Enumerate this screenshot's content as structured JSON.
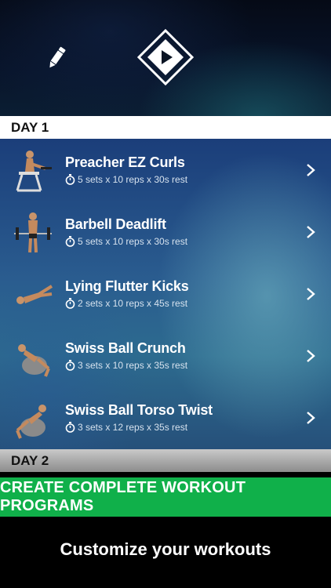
{
  "header": {
    "edit_icon": "pencil-icon",
    "play_icon": "play-icon"
  },
  "days": [
    {
      "label": "DAY 1"
    },
    {
      "label": "DAY 2"
    }
  ],
  "exercises": [
    {
      "name": "Preacher EZ Curls",
      "detail": "5 sets x 10 reps x 30s rest"
    },
    {
      "name": "Barbell Deadlift",
      "detail": "5 sets x 10 reps x 30s rest"
    },
    {
      "name": "Lying Flutter Kicks",
      "detail": "2 sets x 10 reps x 45s rest"
    },
    {
      "name": "Swiss Ball Crunch",
      "detail": "3 sets x 10 reps x 35s rest"
    },
    {
      "name": "Swiss Ball Torso Twist",
      "detail": "3 sets x 12 reps x 35s rest"
    }
  ],
  "banner": {
    "text": "CREATE COMPLETE WORKOUT PROGRAMS",
    "color": "#10b04a"
  },
  "tagline": "Customize your workouts"
}
